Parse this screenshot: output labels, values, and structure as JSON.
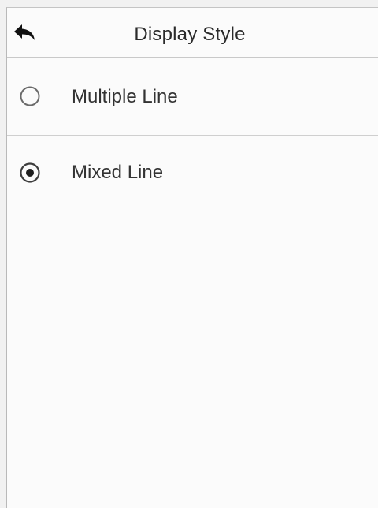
{
  "header": {
    "title": "Display Style",
    "back_icon": "back-arrow-icon"
  },
  "options": [
    {
      "label": "Multiple Line",
      "selected": false
    },
    {
      "label": "Mixed Line",
      "selected": true
    }
  ],
  "colors": {
    "background": "#fbfbfb",
    "divider": "#cfcfcf",
    "text": "#333333",
    "radio": "#555555"
  }
}
